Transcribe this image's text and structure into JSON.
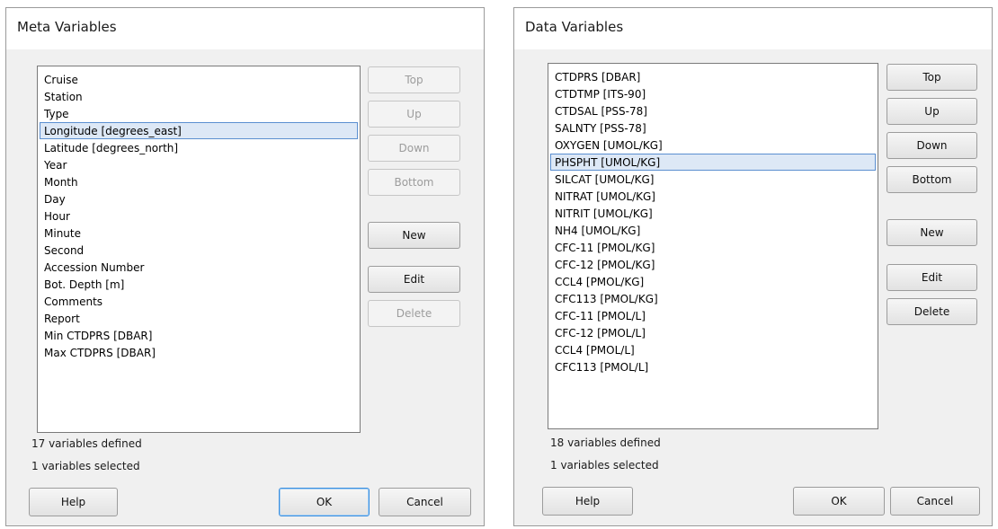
{
  "meta_dialog": {
    "title": "Meta Variables",
    "items": [
      "Cruise",
      "Station",
      "Type",
      "Longitude [degrees_east]",
      "Latitude [degrees_north]",
      "Year",
      "Month",
      "Day",
      "Hour",
      "Minute",
      "Second",
      "Accession Number",
      "Bot. Depth [m]",
      "Comments",
      "Report",
      "Min CTDPRS [DBAR]",
      "Max CTDPRS [DBAR]"
    ],
    "selected_item": "Longitude [degrees_east]",
    "buttons": {
      "top": "Top",
      "up": "Up",
      "down": "Down",
      "bottom": "Bottom",
      "new": "New",
      "edit": "Edit",
      "delete": "Delete",
      "help": "Help",
      "ok": "OK",
      "cancel": "Cancel"
    },
    "status_defined": "17 variables defined",
    "status_selected": "1 variables selected"
  },
  "data_dialog": {
    "title": "Data Variables",
    "items": [
      "CTDPRS [DBAR]",
      "CTDTMP [ITS-90]",
      "CTDSAL [PSS-78]",
      "SALNTY [PSS-78]",
      "OXYGEN [UMOL/KG]",
      "PHSPHT [UMOL/KG]",
      "SILCAT [UMOL/KG]",
      "NITRAT [UMOL/KG]",
      "NITRIT [UMOL/KG]",
      "NH4 [UMOL/KG]",
      "CFC-11 [PMOL/KG]",
      "CFC-12 [PMOL/KG]",
      "CCL4 [PMOL/KG]",
      "CFC113 [PMOL/KG]",
      "CFC-11 [PMOL/L]",
      "CFC-12 [PMOL/L]",
      "CCL4 [PMOL/L]",
      "CFC113 [PMOL/L]"
    ],
    "selected_item": "PHSPHT [UMOL/KG]",
    "buttons": {
      "top": "Top",
      "up": "Up",
      "down": "Down",
      "bottom": "Bottom",
      "new": "New",
      "edit": "Edit",
      "delete": "Delete",
      "help": "Help",
      "ok": "OK",
      "cancel": "Cancel"
    },
    "status_defined": "18 variables defined",
    "status_selected": "1 variables selected"
  }
}
